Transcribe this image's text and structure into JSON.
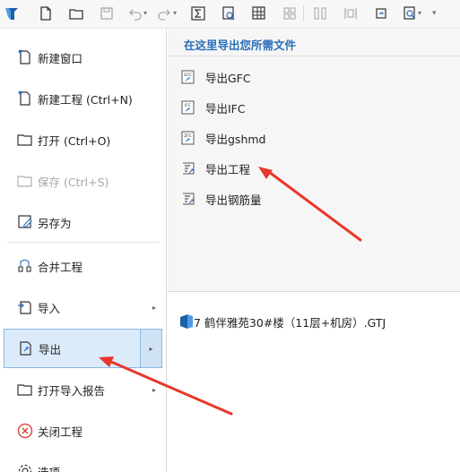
{
  "toolbar": {
    "icons": [
      "app-logo-icon",
      "new-file-icon",
      "open-folder-icon",
      "save-icon",
      "undo-icon",
      "redo-icon",
      "sum-icon",
      "search-report-icon",
      "grid-icon",
      "layers-icon",
      "columns-icon",
      "rotate-icon",
      "search-doc-icon",
      "more-icon"
    ]
  },
  "menu": {
    "items": [
      {
        "label": "新建窗口",
        "icon": "new-window-icon",
        "enabled": true
      },
      {
        "label": "新建工程 (Ctrl+N)",
        "icon": "new-project-icon",
        "enabled": true
      },
      {
        "label": "打开 (Ctrl+O)",
        "icon": "open-icon",
        "enabled": true
      },
      {
        "label": "保存 (Ctrl+S)",
        "icon": "save-icon",
        "enabled": false
      },
      {
        "label": "另存为",
        "icon": "save-as-icon",
        "enabled": true
      },
      {
        "label": "合并工程",
        "icon": "merge-icon",
        "enabled": true
      },
      {
        "label": "导入",
        "icon": "import-icon",
        "enabled": true,
        "submenu": true
      },
      {
        "label": "导出",
        "icon": "export-icon",
        "enabled": true,
        "submenu": true,
        "active": true
      },
      {
        "label": "打开导入报告",
        "icon": "open-report-icon",
        "enabled": true,
        "submenu": true
      },
      {
        "label": "关闭工程",
        "icon": "close-project-icon",
        "enabled": true
      },
      {
        "label": "选项",
        "icon": "options-icon",
        "enabled": true
      }
    ],
    "submenu_glyph": "▸"
  },
  "panel": {
    "title": "在这里导出您所需文件",
    "items": [
      {
        "label": "导出GFC",
        "icon_text": "GFC"
      },
      {
        "label": "导出IFC",
        "icon_text": "IFC"
      },
      {
        "label": "导出gshmd",
        "icon_text": "ZFC"
      },
      {
        "label": "导出工程",
        "icon_text": ""
      },
      {
        "label": "导出钢筋量",
        "icon_text": ""
      }
    ]
  },
  "recent": {
    "label": "7 鹤伴雅苑30#楼（11层+机房）.GTJ"
  },
  "colors": {
    "accent": "#2a6ebb",
    "active_bg": "#dcebfa",
    "active_border": "#8cb8e4",
    "arrow": "#e8372b"
  }
}
